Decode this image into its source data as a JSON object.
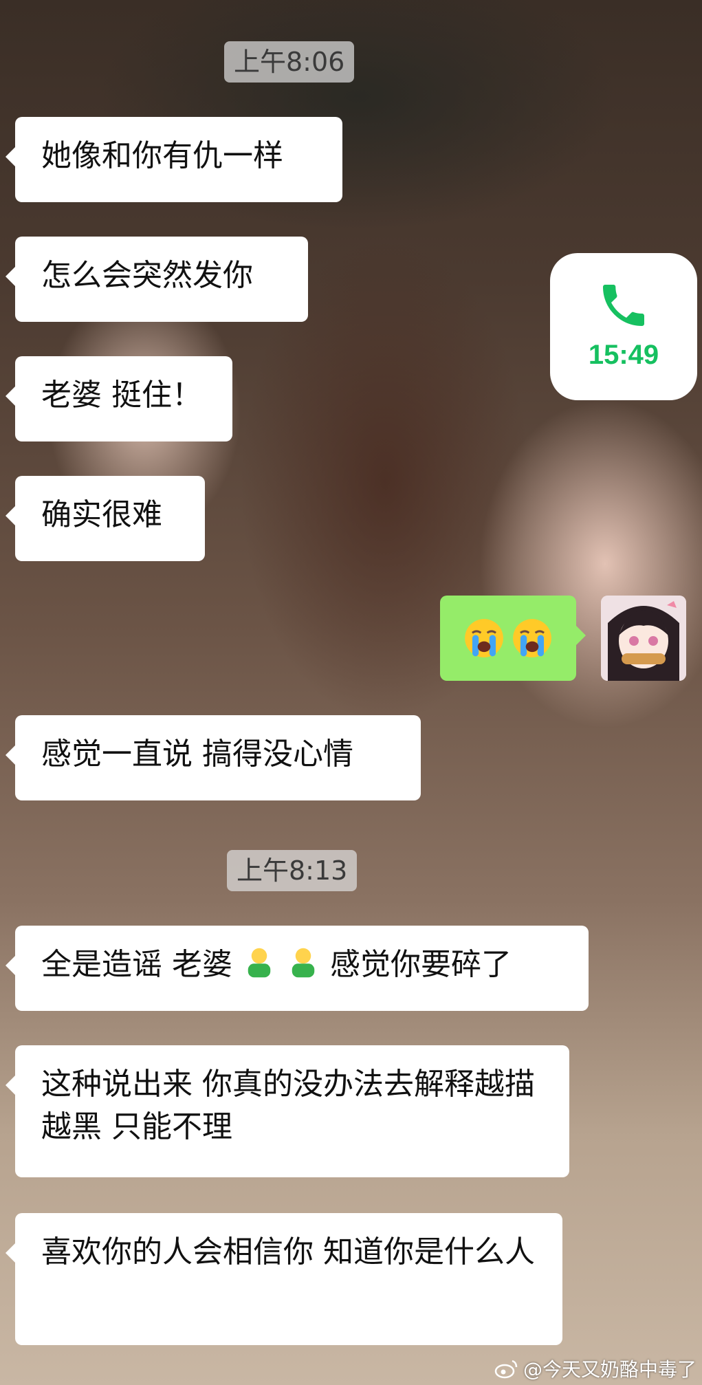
{
  "timestamps": [
    "上午8:06",
    "上午8:13"
  ],
  "messages_in": [
    {
      "text": "她像和你有仇一样"
    },
    {
      "text": "怎么会突然发你"
    },
    {
      "text": "老婆 挺住！"
    },
    {
      "text": "确实很难"
    },
    {
      "text": "感觉一直说 搞得没心情"
    },
    {
      "parts": [
        "全是造谣 老婆",
        "感觉你要碎了"
      ],
      "emoji": "person-bowing-emoji"
    },
    {
      "text": "这种说出来 你真的没办法去解释越描越黑 只能不理"
    },
    {
      "text": "喜欢你的人会相信你 知道你是什么人"
    }
  ],
  "call": {
    "duration": "15:49",
    "icon": "phone-icon",
    "color": "#16c060"
  },
  "sent": {
    "emoji": "loudly-crying-face-emoji",
    "bubble_color": "#95ec69"
  },
  "watermark": {
    "icon": "weibo-icon",
    "text": "@今天又奶酪中毒了"
  }
}
